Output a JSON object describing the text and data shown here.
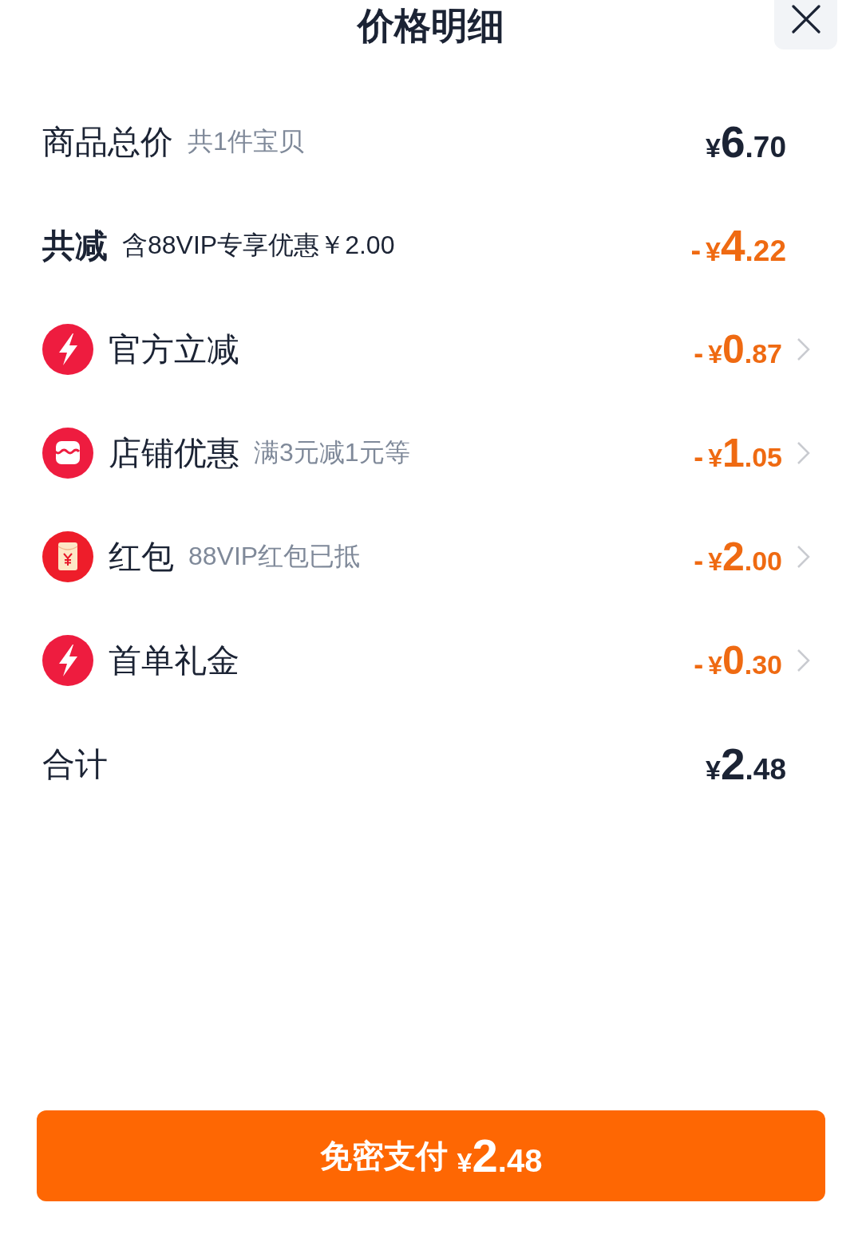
{
  "title": "价格明细",
  "rows": [
    {
      "kind": "total",
      "label": "商品总价",
      "note": "共1件宝贝",
      "price": {
        "currency": "¥",
        "whole": "6",
        "fraction": ".70"
      }
    },
    {
      "kind": "saving",
      "label": "共减",
      "note": "含88VIP专享优惠￥2.00",
      "price": {
        "sign": "-",
        "currency": "¥",
        "whole": "4",
        "fraction": ".22"
      }
    },
    {
      "kind": "flash",
      "label": "官方立减",
      "price": {
        "sign": "-",
        "currency": "¥",
        "whole": "0",
        "fraction": ".87"
      }
    },
    {
      "kind": "shop",
      "label": "店铺优惠",
      "note": "满3元减1元等",
      "price": {
        "sign": "-",
        "currency": "¥",
        "whole": "1",
        "fraction": ".05"
      }
    },
    {
      "kind": "packet",
      "label": "红包",
      "note": "88VIP红包已抵",
      "price": {
        "sign": "-",
        "currency": "¥",
        "whole": "2",
        "fraction": ".00"
      }
    },
    {
      "kind": "flash",
      "label": "首单礼金",
      "price": {
        "sign": "-",
        "currency": "¥",
        "whole": "0",
        "fraction": ".30"
      }
    },
    {
      "kind": "total",
      "label": "合计",
      "price": {
        "currency": "¥",
        "whole": "2",
        "fraction": ".48"
      }
    }
  ],
  "pay_button": {
    "label": "免密支付",
    "price": {
      "currency": "¥",
      "whole": "2",
      "fraction": ".48"
    }
  }
}
